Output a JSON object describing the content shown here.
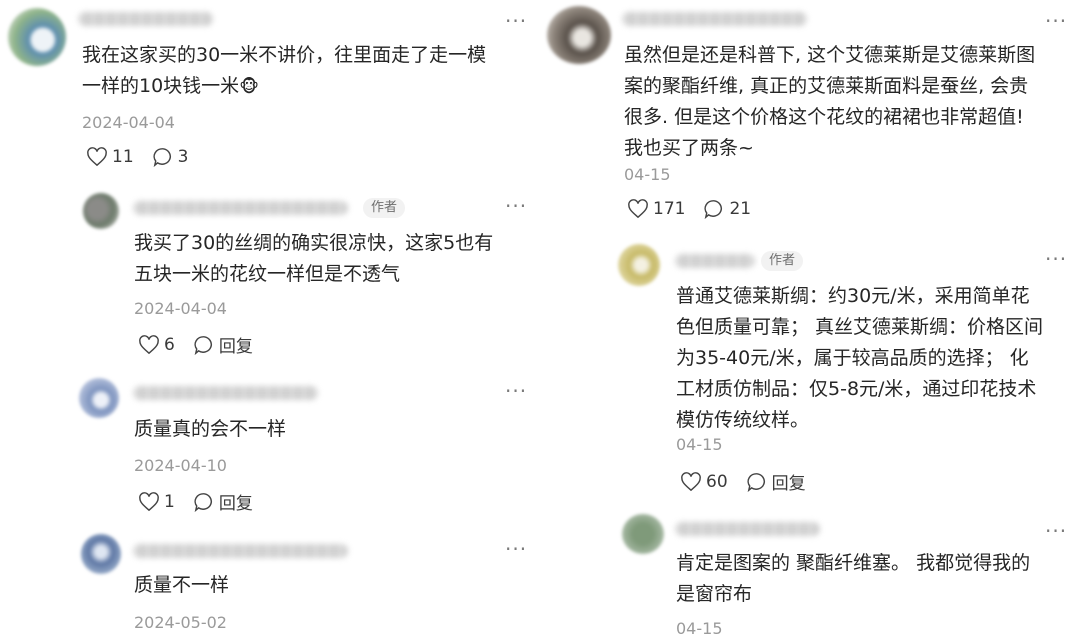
{
  "left": {
    "c1": {
      "text_line1": "我在这家买的30一米不讲价，往里面走了走一模",
      "text_line2": "一样的10块钱一米",
      "emoji": "🐵",
      "date": "2024-04-04",
      "likes": "11",
      "replies": "3"
    },
    "r1": {
      "author_tag": "作者",
      "text_line1": "我买了30的丝绸的确实很凉快，这家5也有",
      "text_line2": "五块一米的花纹一样但是不透气",
      "date": "2024-04-04",
      "likes": "6",
      "reply_label": "回复"
    },
    "r2": {
      "text": "质量真的会不一样",
      "date": "2024-04-10",
      "likes": "1",
      "reply_label": "回复"
    },
    "r3": {
      "text": "质量不一样",
      "date": "2024-05-02"
    }
  },
  "right": {
    "c1": {
      "lines": [
        "虽然但是还是科普下, 这个艾德莱斯是艾德莱斯图",
        "案的聚酯纤维, 真正的艾德莱斯面料是蚕丝, 会贵",
        "很多. 但是这个价格这个花纹的裙裙也非常超值!",
        "我也买了两条~"
      ],
      "date": "04-15",
      "likes": "171",
      "replies": "21"
    },
    "r1": {
      "author_tag": "作者",
      "lines": [
        "普通艾德莱斯绸：约30元/米，采用简单花",
        "色但质量可靠；  真丝艾德莱斯绸：价格区间",
        "为35-40元/米，属于较高品质的选择；  化",
        "工材质仿制品：仅5-8元/米，通过印花技术",
        "模仿传统纹样。"
      ],
      "date": "04-15",
      "likes": "60",
      "reply_label": "回复"
    },
    "r2": {
      "line1": "肯定是图案的 聚酯纤维塞。 我都觉得我的",
      "line2": "是窗帘布",
      "date": "04-15"
    }
  },
  "more_glyph": "···"
}
